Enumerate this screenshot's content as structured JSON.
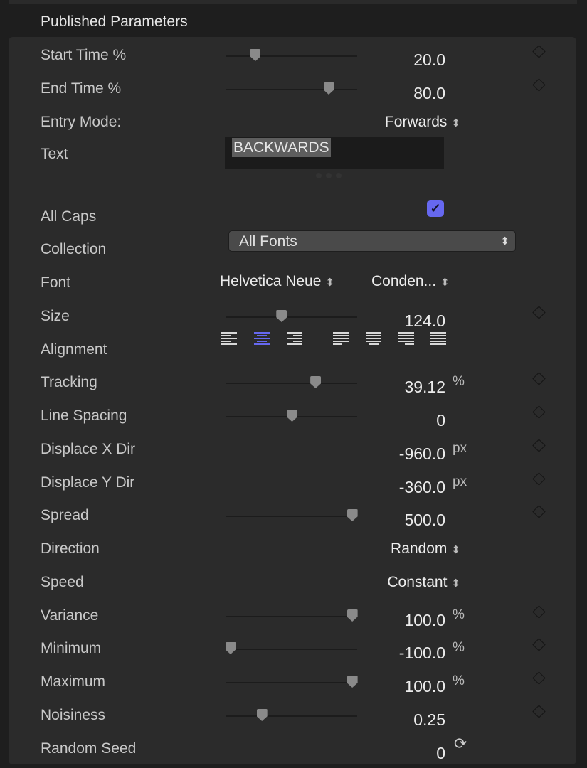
{
  "section_title": "Published Parameters",
  "colors": {
    "accent": "#6668f0",
    "panel": "#2b2b2b",
    "background": "#1e1e1e"
  },
  "rows": [
    {
      "type": "slider",
      "label": "Start Time %",
      "value": "20.0",
      "slider_fraction": 0.22,
      "keyframe": true
    },
    {
      "type": "slider",
      "label": "End Time %",
      "value": "80.0",
      "slider_fraction": 0.78,
      "keyframe": true
    },
    {
      "type": "popup",
      "label": "Entry Mode:",
      "value": "Forwards"
    },
    {
      "type": "text",
      "label": "Text",
      "value": "BACKWARDS"
    },
    {
      "type": "checkbox",
      "label": "All Caps",
      "checked": true
    },
    {
      "type": "select",
      "label": "Collection",
      "value": "All Fonts"
    },
    {
      "type": "font",
      "label": "Font",
      "family": "Helvetica Neue",
      "style": "Conden..."
    },
    {
      "type": "slider",
      "label": "Size",
      "value": "124.0",
      "slider_fraction": 0.42,
      "keyframe": true
    },
    {
      "type": "alignment",
      "label": "Alignment",
      "options": [
        "align-left",
        "align-center",
        "align-right",
        "justify-left",
        "justify-center",
        "justify-right",
        "justify-full"
      ],
      "selected": "align-center"
    },
    {
      "type": "slider",
      "label": "Tracking",
      "value": "39.12",
      "unit": "%",
      "slider_fraction": 0.68,
      "keyframe": true
    },
    {
      "type": "slider",
      "label": "Line Spacing",
      "value": "0",
      "slider_fraction": 0.5,
      "keyframe": true
    },
    {
      "type": "number",
      "label": "Displace X Dir",
      "value": "-960.0",
      "unit": "px",
      "keyframe": true
    },
    {
      "type": "number",
      "label": "Displace Y Dir",
      "value": "-360.0",
      "unit": "px",
      "keyframe": true
    },
    {
      "type": "slider",
      "label": "Spread",
      "value": "500.0",
      "slider_fraction": 0.96,
      "keyframe": true
    },
    {
      "type": "popup",
      "label": "Direction",
      "value": "Random"
    },
    {
      "type": "popup",
      "label": "Speed",
      "value": "Constant"
    },
    {
      "type": "slider",
      "label": "Variance",
      "value": "100.0",
      "unit": "%",
      "slider_fraction": 0.96,
      "keyframe": true
    },
    {
      "type": "slider",
      "label": "Minimum",
      "value": "-100.0",
      "unit": "%",
      "slider_fraction": 0.03,
      "keyframe": true
    },
    {
      "type": "slider",
      "label": "Maximum",
      "value": "100.0",
      "unit": "%",
      "slider_fraction": 0.96,
      "keyframe": true
    },
    {
      "type": "slider",
      "label": "Noisiness",
      "value": "0.25",
      "slider_fraction": 0.27,
      "keyframe": true
    },
    {
      "type": "seed",
      "label": "Random Seed",
      "value": "0",
      "icon": "refresh-icon"
    }
  ]
}
